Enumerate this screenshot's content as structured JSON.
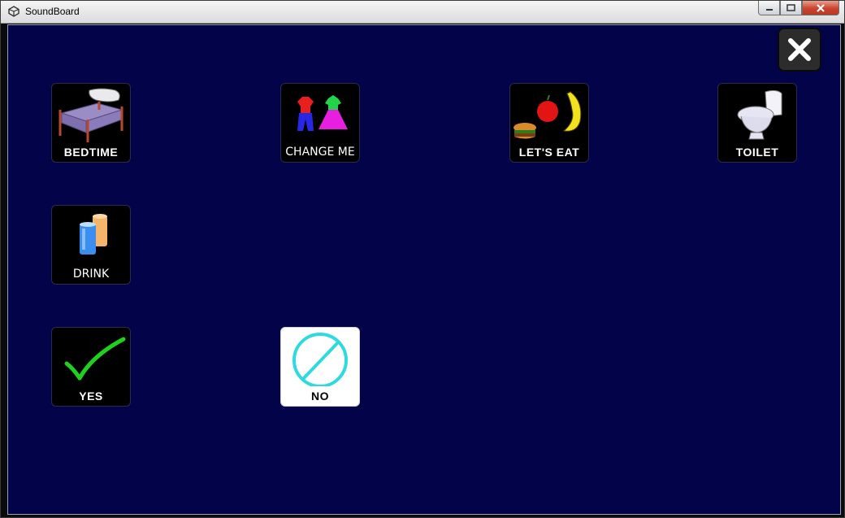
{
  "window": {
    "title": "SoundBoard"
  },
  "board": {
    "tiles": [
      {
        "label": "BEDTIME",
        "icon": "bed-icon"
      },
      {
        "label": "CHANGE ME",
        "icon": "clothes-icon"
      },
      {
        "label": "LET'S EAT",
        "icon": "food-icon"
      },
      {
        "label": "TOILET",
        "icon": "toilet-icon"
      },
      {
        "label": "DRINK",
        "icon": "cups-icon"
      },
      {
        "label": "YES",
        "icon": "checkmark-icon"
      },
      {
        "label": "NO",
        "icon": "no-sign-icon"
      }
    ]
  },
  "colors": {
    "stage": "#03034a",
    "tile": "#000000",
    "check": "#1fd11f",
    "no_sign": "#2fd9e0"
  }
}
